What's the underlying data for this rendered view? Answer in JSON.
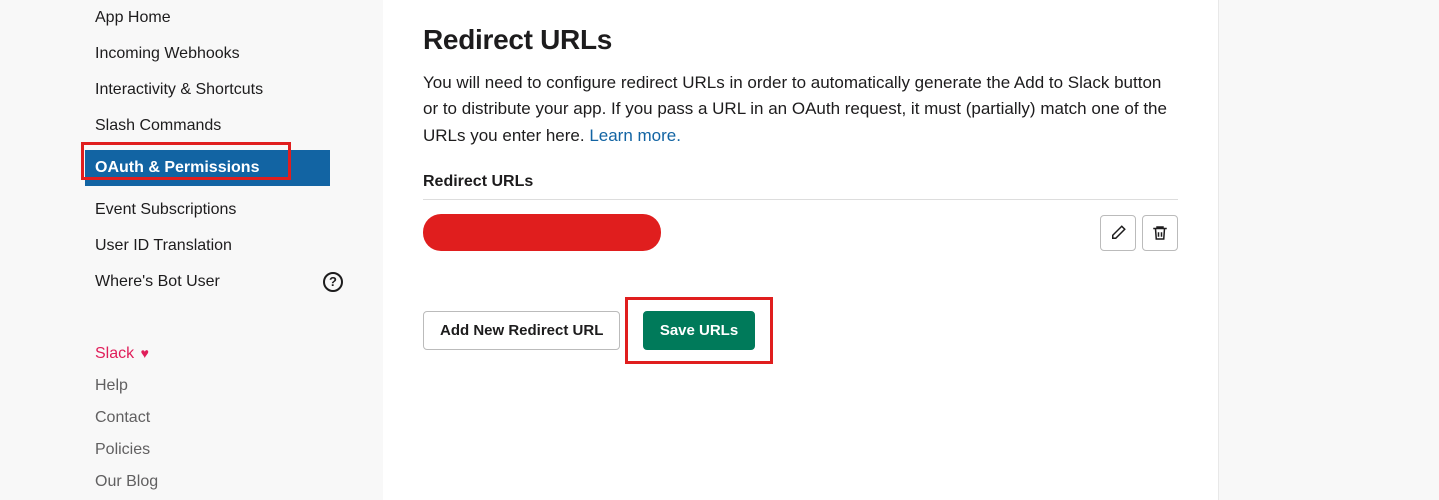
{
  "sidebar": {
    "items": [
      {
        "label": "App Home"
      },
      {
        "label": "Incoming Webhooks"
      },
      {
        "label": "Interactivity & Shortcuts"
      },
      {
        "label": "Slash Commands"
      },
      {
        "label": "OAuth & Permissions"
      },
      {
        "label": "Event Subscriptions"
      },
      {
        "label": "User ID Translation"
      },
      {
        "label": "Where's Bot User"
      }
    ]
  },
  "footer": {
    "slack_label": "Slack",
    "links": [
      {
        "label": "Help"
      },
      {
        "label": "Contact"
      },
      {
        "label": "Policies"
      },
      {
        "label": "Our Blog"
      }
    ]
  },
  "main": {
    "heading": "Redirect URLs",
    "desc_part1": "You will need to configure redirect URLs in order to automatically generate the Add to Slack button or to distribute your app. If you pass a URL in an OAuth request, it must (partially) match one of the URLs you enter here. ",
    "learn_more": "Learn more.",
    "sub_label": "Redirect URLs",
    "add_button": "Add New Redirect URL",
    "save_button": "Save URLs"
  }
}
